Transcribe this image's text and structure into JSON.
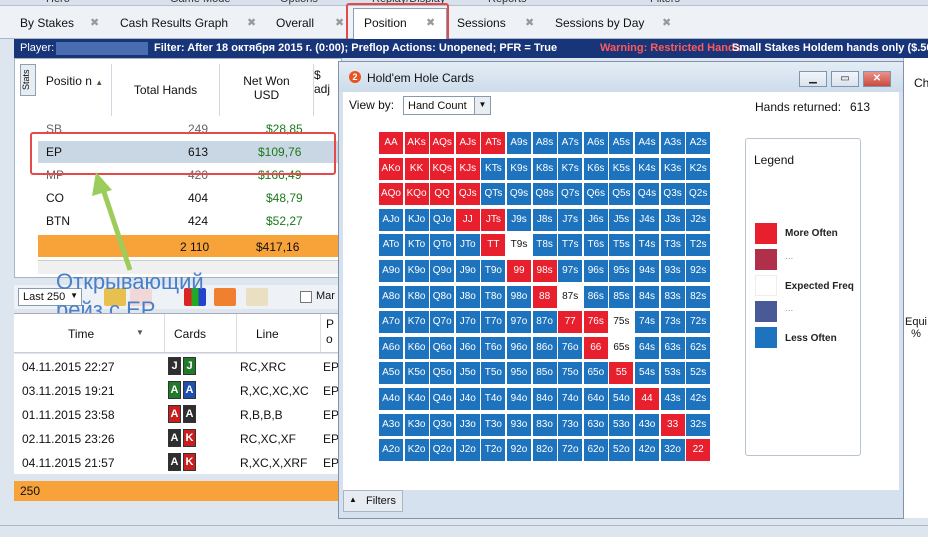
{
  "top_menu": [
    "Hero",
    "Game Mode",
    "Options",
    "Replay/Display",
    "Reports",
    "Filters"
  ],
  "tabs": [
    {
      "label": "By Stakes",
      "selected": false
    },
    {
      "label": "Cash Results Graph",
      "selected": false
    },
    {
      "label": "Overall",
      "selected": false
    },
    {
      "label": "Position",
      "selected": true
    },
    {
      "label": "Sessions",
      "selected": false
    },
    {
      "label": "Sessions by Day",
      "selected": false
    }
  ],
  "filter_bar": {
    "player_label": "Player:",
    "filter_text": "Filter: After 18 октября 2015 г. (0:00); Preflop Actions: Unopened; PFR = True",
    "warning": "Warning: Restricted Hands",
    "stakes": "Small Stakes Holdem hands only ($.50"
  },
  "position_table": {
    "stats_tab": "Stats",
    "columns": [
      "Positio n",
      "Total Hands",
      "Net Won USD",
      "$ adj"
    ],
    "rows": [
      {
        "position": "SB",
        "hands": "249",
        "net": "$28,85"
      },
      {
        "position": "EP",
        "hands": "613",
        "net": "$109,76"
      },
      {
        "position": "MP",
        "hands": "420",
        "net": "$166,49"
      },
      {
        "position": "CO",
        "hands": "404",
        "net": "$48,79"
      },
      {
        "position": "BTN",
        "hands": "424",
        "net": "$52,27"
      }
    ],
    "total": {
      "hands": "2 110",
      "net": "$417,16"
    }
  },
  "annotation": {
    "line1": "Открывающий",
    "line2": "рейз с EP"
  },
  "session_toolbar": {
    "last_select": "Last 250",
    "checkbox_label": "Mar"
  },
  "sessions_table": {
    "columns": [
      "Time",
      "Cards",
      "Line",
      "P o"
    ],
    "rows": [
      {
        "time": "04.11.2015 22:27",
        "c1": "J",
        "c2": "J",
        "c1color": "#2e2e2e",
        "c2color": "#1f7a2a",
        "line": "RC,XRC",
        "p": "EP"
      },
      {
        "time": "03.11.2015 19:21",
        "c1": "A",
        "c2": "A",
        "c1color": "#1f7a2a",
        "c2color": "#1e4fb0",
        "line": "R,XC,XC,XC",
        "p": "EP"
      },
      {
        "time": "01.11.2015 23:58",
        "c1": "A",
        "c2": "A",
        "c1color": "#c81e1e",
        "c2color": "#2e2e2e",
        "line": "R,B,B,B",
        "p": "EP"
      },
      {
        "time": "02.11.2015 23:26",
        "c1": "A",
        "c2": "K",
        "c1color": "#2e2e2e",
        "c2color": "#c81e1e",
        "line": "RC,XC,XF",
        "p": "EP"
      },
      {
        "time": "04.11.2015 21:57",
        "c1": "A",
        "c2": "K",
        "c1color": "#2e2e2e",
        "c2color": "#c81e1e",
        "line": "R,XC,X,XRF",
        "p": "EP"
      }
    ],
    "total_count": "250"
  },
  "right_pane": {
    "col1": "Ch",
    "col2": "Equi %"
  },
  "dialog": {
    "title": "Hold'em Hole Cards",
    "icon": "2",
    "view_by_label": "View by:",
    "view_by_value": "Hand Count",
    "hands_returned_label": "Hands returned:",
    "hands_returned_value": "613",
    "filters_label": "Filters",
    "legend": {
      "title": "Legend",
      "items": [
        {
          "label": "More Often",
          "color": "#e8202d"
        },
        {
          "label": "...",
          "color": "#b0304a"
        },
        {
          "label": "Expected Freq",
          "color": "#ffffff"
        },
        {
          "label": "...",
          "color": "#4a5a96"
        },
        {
          "label": "Less Often",
          "color": "#1e73be"
        }
      ]
    },
    "colors": {
      "red": "#e8202d",
      "blue": "#1e73be",
      "white": "#ffffff"
    },
    "grid_red": [
      "AA",
      "AKs",
      "AQs",
      "AJs",
      "ATs",
      "AKo",
      "KK",
      "KQs",
      "KJs",
      "AQo",
      "KQo",
      "QQ",
      "QJs",
      "JJ",
      "JTs",
      "TT",
      "99",
      "98s",
      "88",
      "77",
      "76s",
      "66",
      "55",
      "44",
      "33",
      "22"
    ],
    "grid_white": [
      "T9s",
      "87s",
      "75s",
      "65s"
    ]
  }
}
